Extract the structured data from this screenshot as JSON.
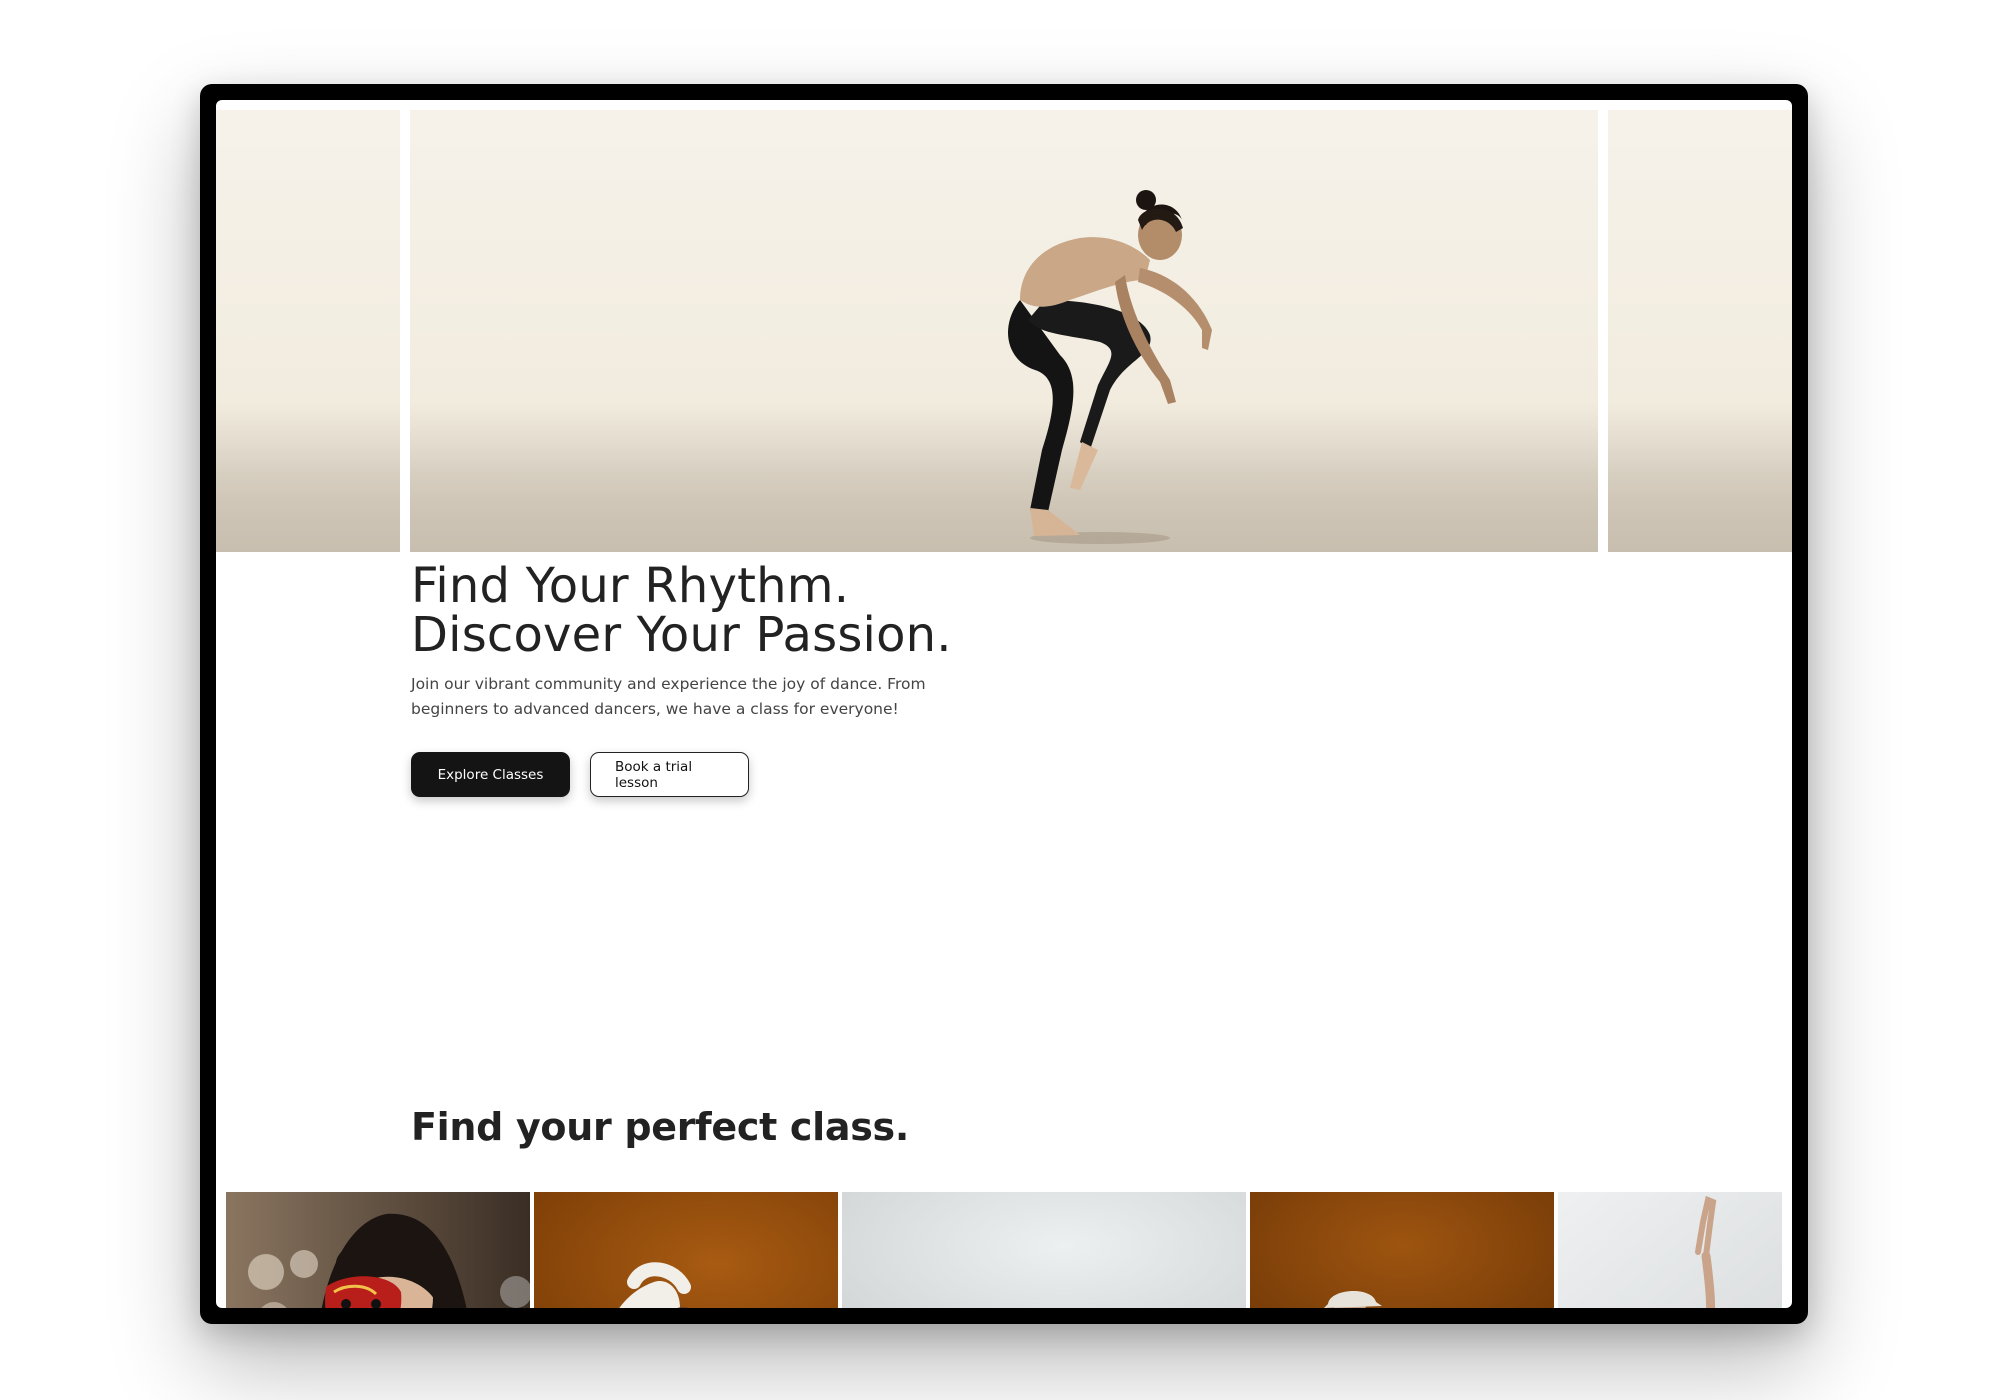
{
  "hero": {
    "headline_line1": "Find Your Rhythm.",
    "headline_line2": "Discover Your Passion.",
    "subtext": "Join our vibrant community and experience the joy of dance. From beginners to advanced dancers, we have a class for everyone!",
    "primary_cta": "Explore Classes",
    "secondary_cta": "Book a trial lesson"
  },
  "classes": {
    "title": "Find your perfect class.",
    "tiles": [
      {
        "image": "woman-with-red-mask"
      },
      {
        "image": "dancer-in-white-on-orange"
      },
      {
        "image": "dancer-bending-on-grey"
      },
      {
        "image": "hiphop-dancer-in-hat-on-orange"
      },
      {
        "image": "dancer-arm-raised-on-grey"
      }
    ]
  },
  "colors": {
    "primary_button_bg": "#141414",
    "primary_button_text": "#ffffff",
    "heading_text": "#222222",
    "orange_backdrop": "#8a4608",
    "grey_backdrop": "#dfe2e3"
  }
}
